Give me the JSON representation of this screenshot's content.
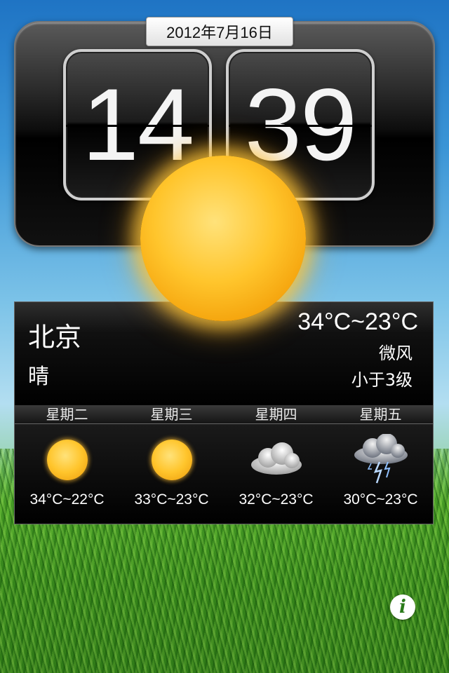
{
  "clock": {
    "date": "2012年7月16日",
    "hours": "14",
    "minutes": "39"
  },
  "current": {
    "city": "北京",
    "condition": "晴",
    "temp_range": "34°C~23°C",
    "wind_desc": "微风",
    "wind_level": "小于3级",
    "icon": "sun-icon"
  },
  "forecast": [
    {
      "day": "星期二",
      "temp": "34°C~22°C",
      "icon": "sun-icon"
    },
    {
      "day": "星期三",
      "temp": "33°C~23°C",
      "icon": "sun-icon"
    },
    {
      "day": "星期四",
      "temp": "32°C~23°C",
      "icon": "cloud-icon"
    },
    {
      "day": "星期五",
      "temp": "30°C~23°C",
      "icon": "thunderstorm-icon"
    }
  ],
  "info": {
    "label": "i"
  },
  "colors": {
    "sun": "#ffc52c",
    "panel": "#000000",
    "info_icon": "#2a7a1a"
  }
}
